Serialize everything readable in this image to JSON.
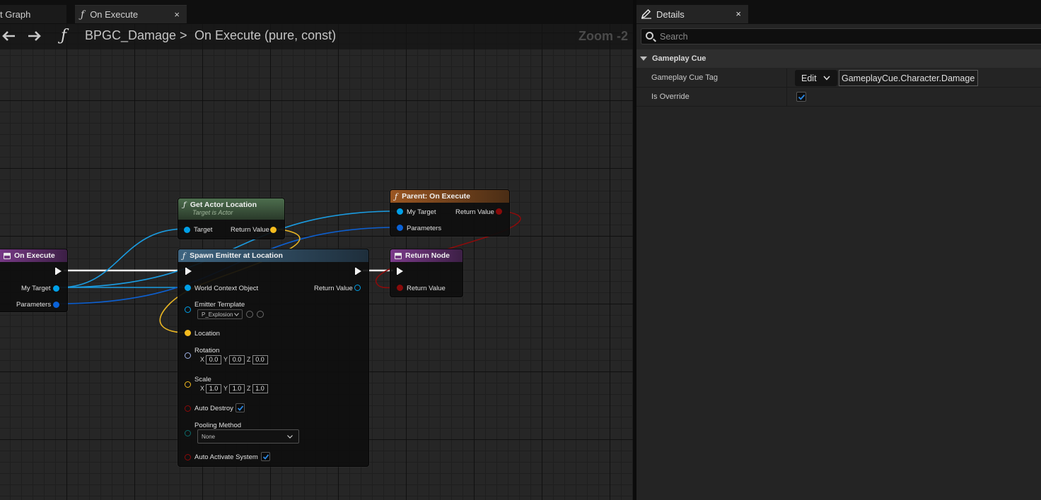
{
  "graph_tabs": [
    {
      "label": "t Graph",
      "active": false
    },
    {
      "label": "On Execute",
      "active": true
    }
  ],
  "breadcrumb": {
    "function_glyph": "ƒ",
    "blueprint": "BPGC_Damage",
    "separator": ">",
    "function": "On Execute (pure, const)"
  },
  "zoom": "Zoom -2",
  "nodes": {
    "on_execute": {
      "title": "On Execute",
      "pins": {
        "target": "My Target",
        "params": "Parameters"
      }
    },
    "get_actor_location": {
      "title": "Get Actor Location",
      "subtitle": "Target is Actor",
      "pins": {
        "target": "Target",
        "return": "Return Value"
      }
    },
    "parent_on_execute": {
      "title": "Parent: On Execute",
      "pins": {
        "target": "My Target",
        "return": "Return Value",
        "params": "Parameters"
      }
    },
    "spawn_emitter": {
      "title": "Spawn Emitter at Location",
      "pins": {
        "world": "World Context Object",
        "return": "Return Value",
        "template": "Emitter Template",
        "template_value": "P_Explosion",
        "location": "Location",
        "rotation": "Rotation",
        "rotation_x": "0.0",
        "rotation_y": "0.0",
        "rotation_z": "0.0",
        "scale": "Scale",
        "scale_x": "1.0",
        "scale_y": "1.0",
        "scale_z": "1.0",
        "auto_destroy": "Auto Destroy",
        "pooling": "Pooling Method",
        "pooling_value": "None",
        "auto_activate": "Auto Activate System"
      },
      "axis": {
        "x": "X",
        "y": "Y",
        "z": "Z"
      },
      "auto_destroy_checked": true,
      "auto_activate_checked": true
    },
    "return_node": {
      "title": "Return Node",
      "pins": {
        "return": "Return Value"
      }
    }
  },
  "details": {
    "tab_label": "Details",
    "close": "×",
    "search_placeholder": "Search",
    "category": "Gameplay Cue",
    "rows": {
      "tag_label": "Gameplay Cue Tag",
      "edit_label": "Edit",
      "tag_value": "GameplayCue.Character.Damage",
      "override_label": "Is Override",
      "override_checked": true
    }
  },
  "colors": {
    "accent_blue": "#2a86e0",
    "pin_object_blue": "#00a0e8",
    "pin_struct_blue": "#0a62d8",
    "pin_vector_yellow": "#f5bb1e",
    "pin_bool_red": "#8a0a0a",
    "header_function_blue": "#35506a",
    "header_pure_green": "#47684a",
    "header_parent_orange": "#8c4d1d",
    "header_event_purple": "#6a2f78"
  },
  "icons": [
    "function-icon",
    "back-arrow-icon",
    "forward-arrow-icon",
    "close-icon",
    "details-pencil-icon",
    "search-icon",
    "expand-triangle-icon",
    "chevron-down-icon",
    "checkmark-icon"
  ]
}
